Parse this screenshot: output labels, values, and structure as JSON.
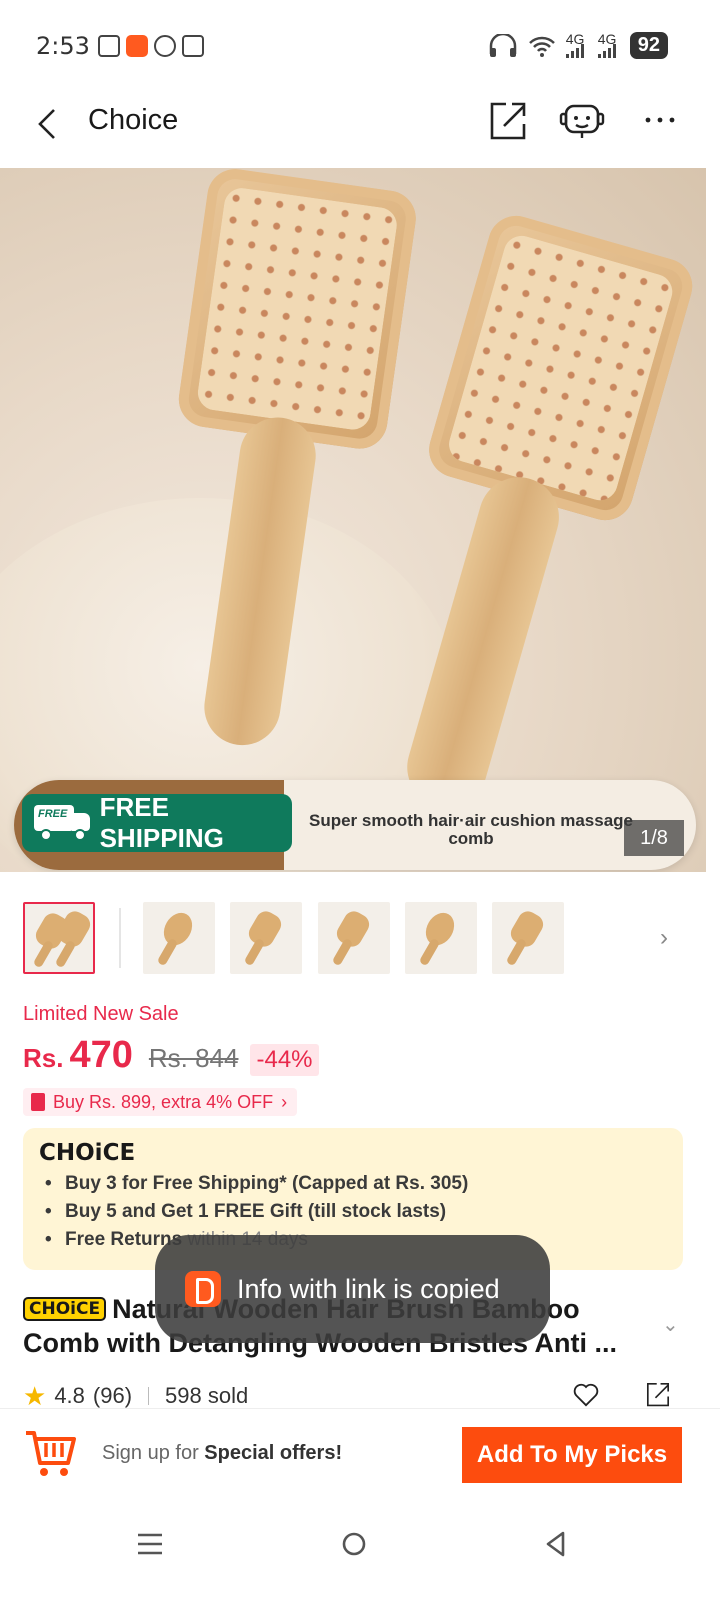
{
  "status_bar": {
    "time": "2:53",
    "battery": "92",
    "network_1": "4G",
    "network_2": "4G"
  },
  "header": {
    "title": "Choice"
  },
  "gallery": {
    "counter": "1/8",
    "free_shipping": "FREE SHIPPING",
    "free_badge": "FREE",
    "banner_text": "Super smooth hair·air cushion massage comb"
  },
  "price": {
    "promo_label": "Limited New Sale",
    "currency": "Rs.",
    "current": "470",
    "original": "Rs. 844",
    "discount": "-44%",
    "coupon": "Buy Rs. 899, extra 4% OFF"
  },
  "choice_box": {
    "logo": "CHOiCE",
    "benefits": [
      "Buy 3 for  Free Shipping* (Capped at Rs. 305)",
      "Buy 5 and Get 1 FREE Gift (till stock lasts)"
    ],
    "returns_bold": "Free Returns",
    "returns_light": " within 14 days"
  },
  "product": {
    "tag": "CHOiCE",
    "title": "Natural Wooden Hair Brush Bamboo Comb with Detangling Wooden Bristles Anti ...",
    "rating": "4.8",
    "reviews": "(96)",
    "sold": "598 sold"
  },
  "toast": {
    "message": "Info with link is copied"
  },
  "bottom_bar": {
    "signup_prefix": "Sign up for ",
    "signup_bold": "Special offers!",
    "cta": "Add To My Picks"
  },
  "colors": {
    "accent_red": "#e8294b",
    "cta_orange": "#fd4c0e",
    "choice_bg": "#fff5d5",
    "free_ship_green": "#0f7a5c"
  }
}
